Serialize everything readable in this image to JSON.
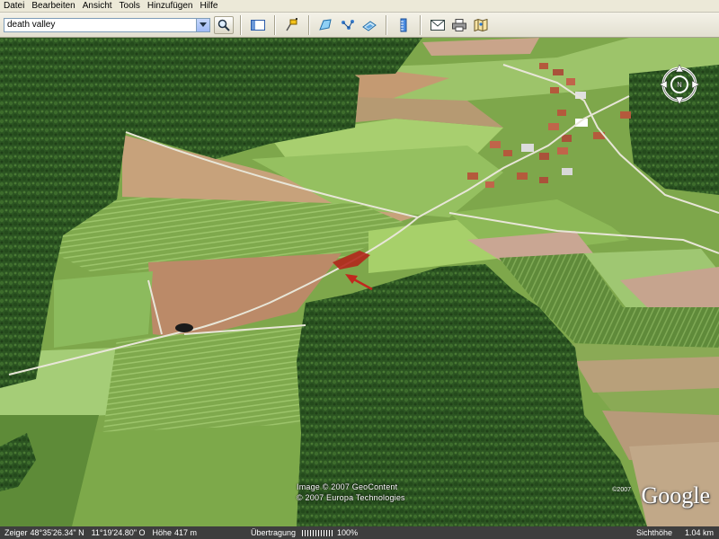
{
  "menu": {
    "items": [
      "Datei",
      "Bearbeiten",
      "Ansicht",
      "Tools",
      "Hinzufügen",
      "Hilfe"
    ]
  },
  "search": {
    "value": "death valley"
  },
  "map": {
    "copyright_line1": "Image © 2007 GeoContent",
    "copyright_line2": "© 2007 Europa Technologies",
    "logo_text": "Google",
    "logo_year": "©2007",
    "compass_letter": "N"
  },
  "status": {
    "pointer_label": "Zeiger",
    "latitude": "48°35'26.34\" N",
    "longitude": "11°19'24.80\" O",
    "elevation_label": "Höhe",
    "elevation": "417 m",
    "streaming_label": "Übertragung",
    "streaming_percent": "100%",
    "eye_alt_label": "Sichthöhe",
    "eye_alt": "1.04 km"
  },
  "colors": {
    "forest": "#2f5a24",
    "field_light": "#8fbf5a",
    "field_brown": "#b88f6a",
    "marker_red": "#c0281e"
  }
}
